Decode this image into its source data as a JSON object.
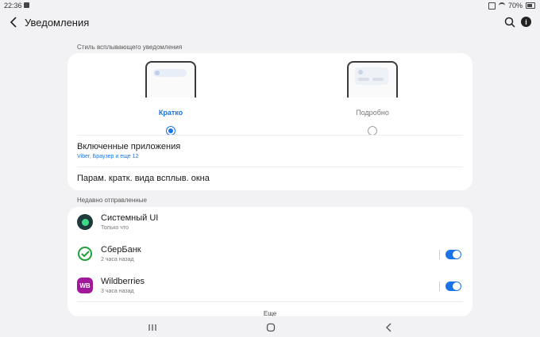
{
  "status_bar": {
    "time": "22:36",
    "battery": "70%"
  },
  "app_bar": {
    "title": "Уведомления"
  },
  "popup_style": {
    "header": "Стиль всплывающего уведомления",
    "options": [
      {
        "label": "Кратко",
        "selected": true,
        "color": "#1a73e8"
      },
      {
        "label": "Подробно",
        "selected": false,
        "color": "#777777"
      }
    ],
    "enabled_apps": {
      "title": "Включенные приложения",
      "subtitle": "Viber, Браузер и еще 12"
    },
    "brief_settings": {
      "title": "Парам. кратк. вида всплыв. окна"
    }
  },
  "recent": {
    "header": "Недавно отправленные",
    "apps": [
      {
        "name": "Системный UI",
        "time": "Только что",
        "icon": "system-ui-icon",
        "toggle": null
      },
      {
        "name": "СберБанк",
        "time": "2 часа назад",
        "icon": "sberbank-icon",
        "toggle": true
      },
      {
        "name": "Wildberries",
        "time": "3 часа назад",
        "icon": "wildberries-icon",
        "icon_text": "WB",
        "toggle": true
      }
    ],
    "more_label": "Еще"
  },
  "colors": {
    "accent": "#1a73e8",
    "background": "#f2f2f4",
    "wildberries": "#a0199b",
    "sber": "#21a038"
  }
}
